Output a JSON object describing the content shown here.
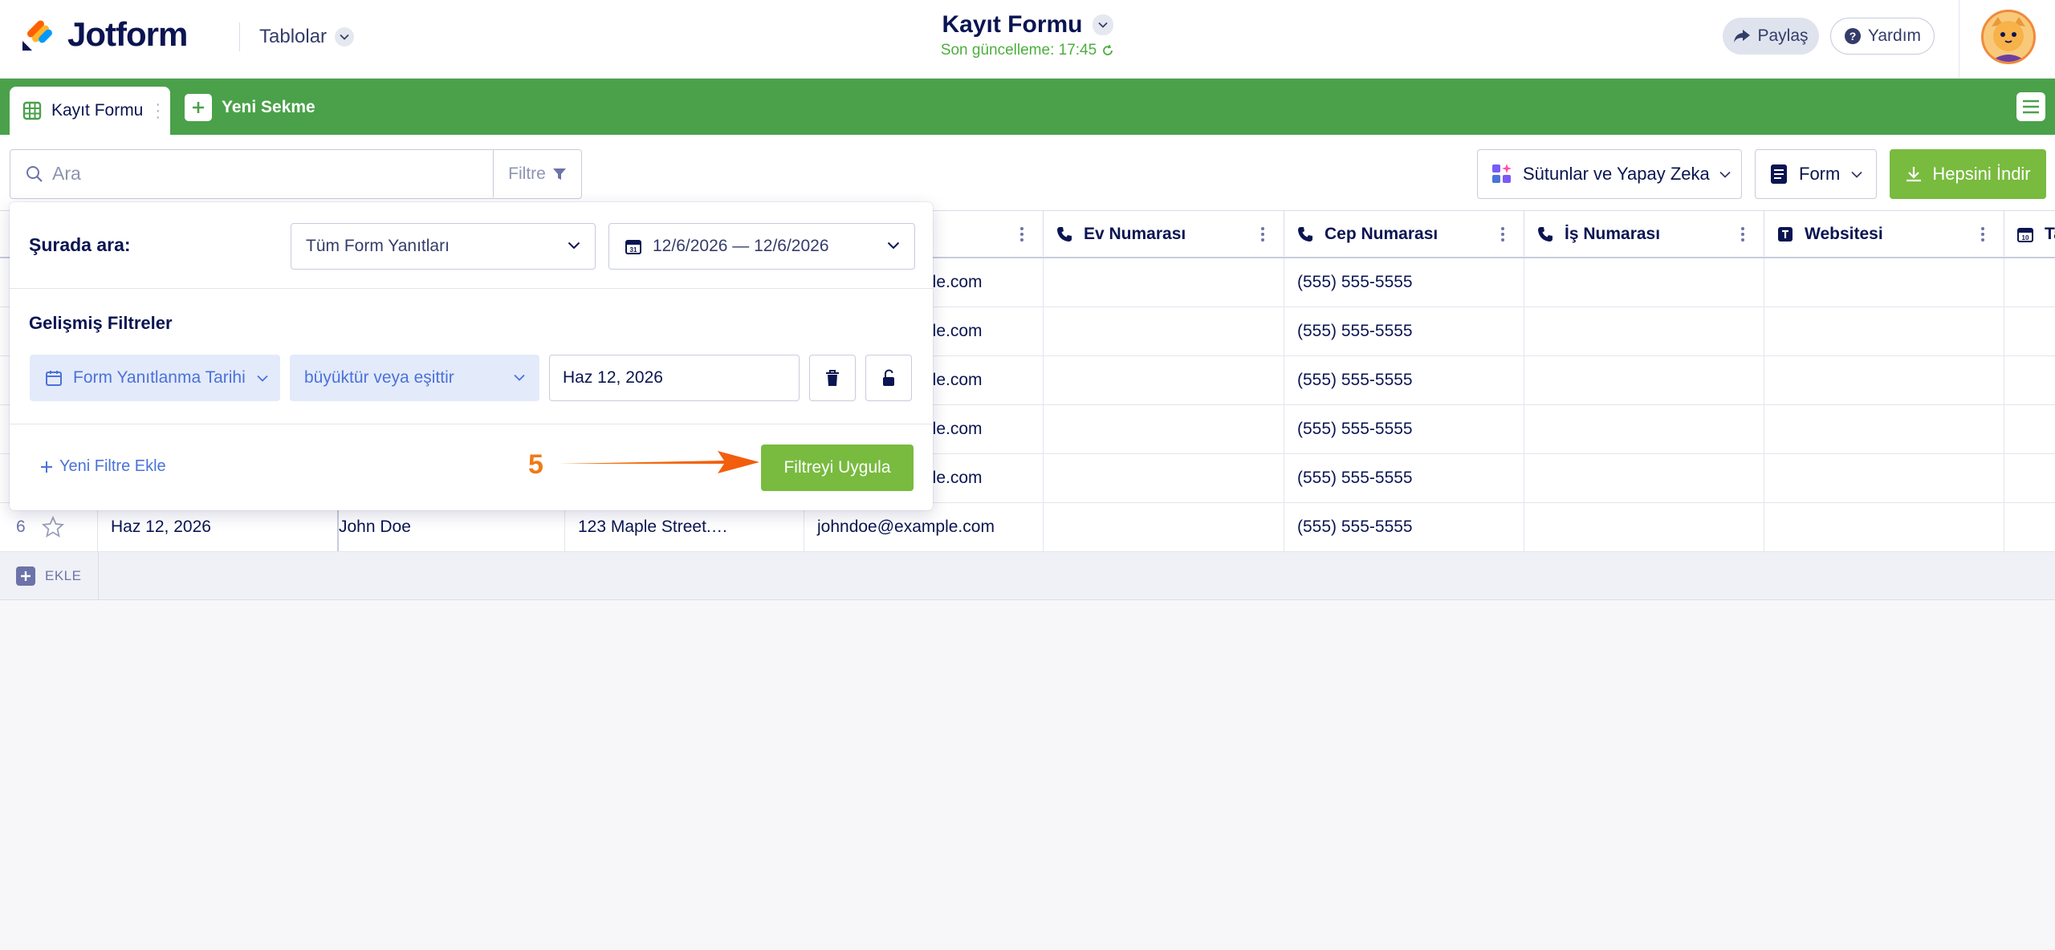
{
  "header": {
    "brand": "Jotform",
    "tables_menu": "Tablolar",
    "form_title": "Kayıt Formu",
    "last_update": "Son güncelleme: 17:45",
    "share": "Paylaş",
    "help": "Yardım"
  },
  "tabs": {
    "active": "Kayıt Formu",
    "new_tab": "Yeni Sekme"
  },
  "toolbar": {
    "search_placeholder": "Ara",
    "filter": "Filtre",
    "columns_ai": "Sütunlar ve Yapay Zeka",
    "form": "Form",
    "download_all": "Hepsini İndir"
  },
  "filter_panel": {
    "search_in_label": "Şurada ara:",
    "scope": "Tüm Form Yanıtları",
    "date_range": "12/6/2026 — 12/6/2026",
    "advanced_title": "Gelişmiş Filtreler",
    "field": "Form Yanıtlanma Tarihi",
    "operator": "büyüktür veya eşittir",
    "value": "Haz 12, 2026",
    "add_filter": "Yeni Filtre Ekle",
    "apply": "Filtreyi Uygula",
    "step": "5"
  },
  "columns": [
    "Ev Numarası",
    "Cep Numarası",
    "İş Numarası",
    "Websitesi",
    "Ta"
  ],
  "rows": [
    {
      "email_tail": "ple.com",
      "cell": "(555) 555-5555"
    },
    {
      "email_tail": "ple.com",
      "cell": "(555) 555-5555"
    },
    {
      "email_tail": "ple.com",
      "cell": "(555) 555-5555"
    },
    {
      "email_tail": "ple.com",
      "cell": "(555) 555-5555"
    },
    {
      "email_tail": "ple.com",
      "cell": "(555) 555-5555"
    }
  ],
  "last_row": {
    "num": "6",
    "date": "Haz 12, 2026",
    "name": "John Doe",
    "address": "123 Maple Street.…",
    "email": "johndoe@example.com",
    "cell": "(555) 555-5555"
  },
  "add_row_label": "EKLE",
  "colors": {
    "brand_green": "#4aa14a",
    "accent_green": "#78bb3f",
    "navy": "#0a1551",
    "link_blue": "#4b72d9",
    "annotation_orange": "#f07a14"
  }
}
